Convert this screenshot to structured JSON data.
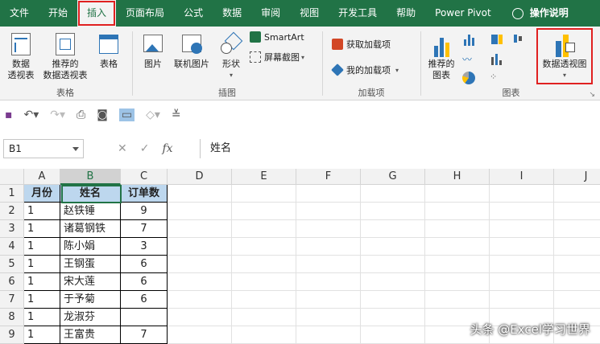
{
  "tabs": [
    "文件",
    "开始",
    "插入",
    "页面布局",
    "公式",
    "数据",
    "审阅",
    "视图",
    "开发工具",
    "帮助",
    "Power Pivot",
    "操作说明"
  ],
  "active_tab_index": 2,
  "ribbon": {
    "tables": {
      "label": "表格",
      "pivot_table": "数据\n透视表",
      "recommended_pivot": "推荐的\n数据透视表",
      "table": "表格"
    },
    "illustrations": {
      "label": "插图",
      "pictures": "图片",
      "online_pictures": "联机图片",
      "shapes": "形状",
      "smartart": "SmartArt",
      "screenshot": "屏幕截图"
    },
    "addins": {
      "label": "加载项",
      "get_addins": "获取加载项",
      "my_addins": "我的加载项"
    },
    "charts": {
      "label": "图表",
      "recommended_charts": "推荐的\n图表",
      "pivot_chart": "数据透视图"
    }
  },
  "namebox": "B1",
  "formula": "姓名",
  "columns": [
    "A",
    "B",
    "C",
    "D",
    "E",
    "F",
    "G",
    "H",
    "I",
    "J"
  ],
  "rows": [
    [
      "月份",
      "姓名",
      "订单数"
    ],
    [
      "1",
      "赵铁锤",
      "9"
    ],
    [
      "1",
      "诸葛钢铁",
      "7"
    ],
    [
      "1",
      "陈小娟",
      "3"
    ],
    [
      "1",
      "王钢蛋",
      "6"
    ],
    [
      "1",
      "宋大莲",
      "6"
    ],
    [
      "1",
      "于予菊",
      "6"
    ],
    [
      "1",
      "龙淑芬",
      ""
    ],
    [
      "1",
      "王富贵",
      "7"
    ]
  ],
  "watermark": "头条 @Excel学习世界",
  "colors": {
    "excel_green": "#217346",
    "header_fill": "#bdd7ee",
    "highlight": "#e02020"
  }
}
